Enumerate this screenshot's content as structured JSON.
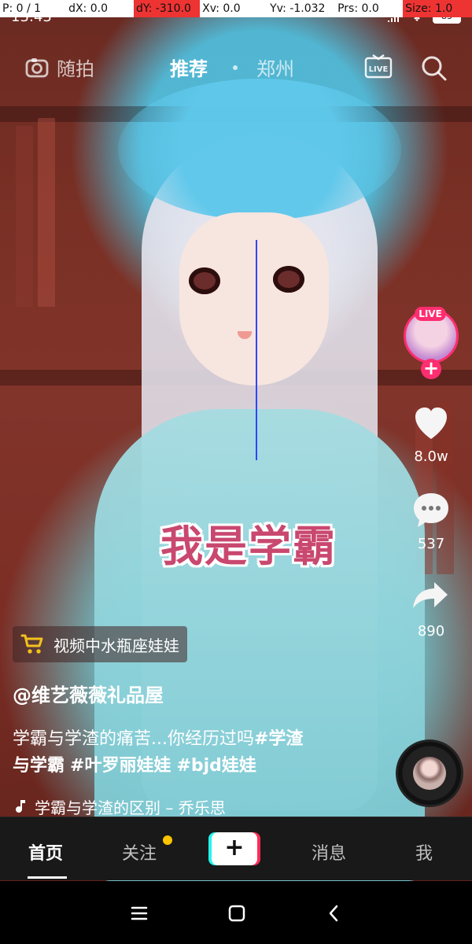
{
  "debug": {
    "p": "P: 0 / 1",
    "dx": "dX: 0.0",
    "dy": "dY: -310.0",
    "xv": "Xv: 0.0",
    "yv": "Yv: -1.032",
    "prs": "Prs: 0.0",
    "size": "Size: 1.0"
  },
  "status": {
    "time": "13:43",
    "battery": "83"
  },
  "top_nav": {
    "shoot": "随拍",
    "recommend": "推荐",
    "city": "郑州"
  },
  "overlay": {
    "text": "我是学霸"
  },
  "right_rail": {
    "live_badge": "LIVE",
    "likes": "8.0w",
    "comments": "537",
    "shares": "890"
  },
  "product": {
    "label": "视频中水瓶座娃娃"
  },
  "post": {
    "author": "@维艺薇薇礼品屋",
    "caption_line1_prefix": "学霸与学渣的痛苦...你经历过吗",
    "tag1": "#学渣",
    "caption_line2_prefix": "与学霸",
    "tag2": "#叶罗丽娃娃",
    "tag3": "#bjd娃娃",
    "music": "学霸与学渣的区别 – 乔乐思"
  },
  "bottom_nav": {
    "home": "首页",
    "follow": "关注",
    "messages": "消息",
    "me": "我"
  },
  "colors": {
    "accent_pink": "#fe2c55",
    "accent_cyan": "#24f4ee",
    "notification_yellow": "#ffc400"
  }
}
